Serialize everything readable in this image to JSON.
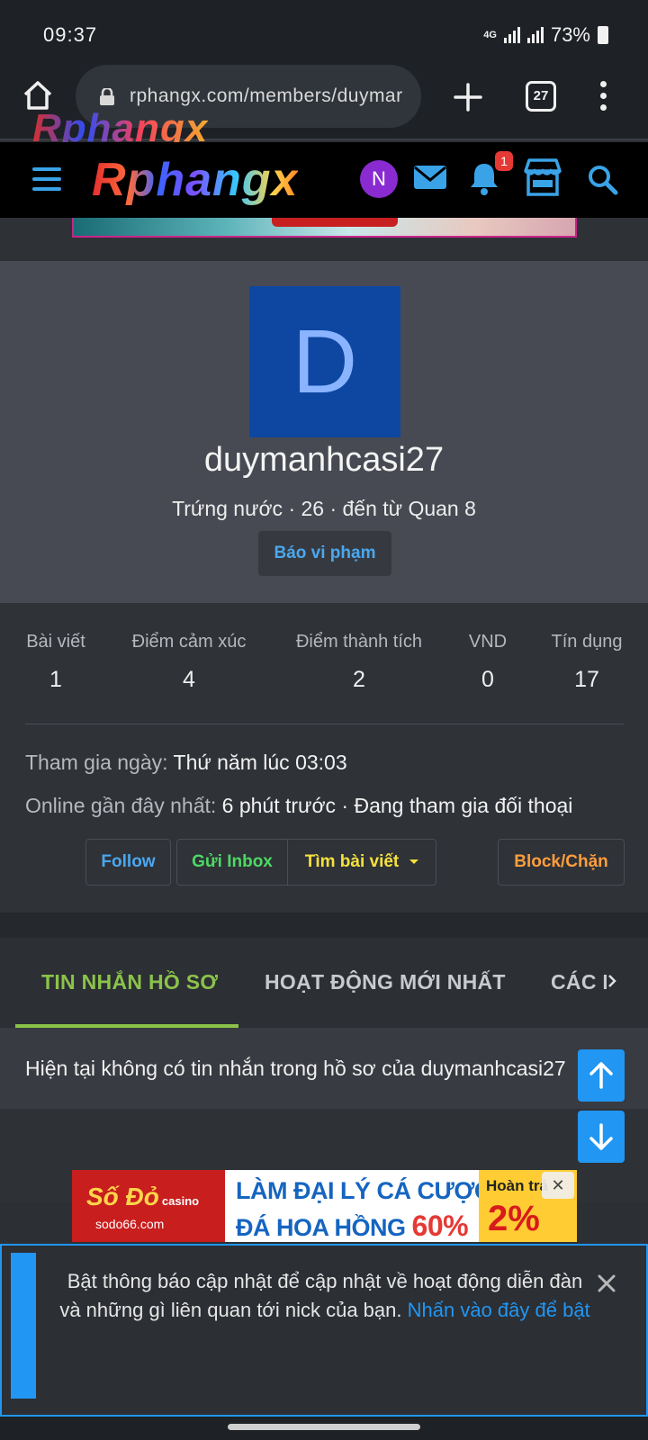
{
  "status_bar": {
    "time": "09:37",
    "network": "4G",
    "battery": "73%"
  },
  "browser": {
    "url": "rphangx.com/members/duymar",
    "tabs_count": "27",
    "watermark": "Rphangx"
  },
  "header": {
    "logo": "Rphangx",
    "avatar_letter": "N",
    "notification_count": "1",
    "accent_color": "#3aa3e8"
  },
  "profile": {
    "avatar_letter": "D",
    "username": "duymanhcasi27",
    "info": "Trứng nước · 26 · đến từ Quan 8",
    "report_label": "Báo vi phạm"
  },
  "stats": [
    {
      "label": "Bài viết",
      "value": "1"
    },
    {
      "label": "Điểm cảm xúc",
      "value": "4"
    },
    {
      "label": "Điểm thành tích",
      "value": "2"
    },
    {
      "label": "VND",
      "value": "0"
    },
    {
      "label": "Tín dụng",
      "value": "17"
    }
  ],
  "joined": {
    "label": "Tham gia ngày:",
    "value": "Thứ năm lúc 03:03"
  },
  "last_seen": {
    "label": "Online gần đây nhất:",
    "value": "6 phút trước · Đang tham gia đối thoại"
  },
  "actions": {
    "follow": "Follow",
    "inbox": "Gửi Inbox",
    "find_posts": "Tìm bài viết",
    "block": "Block/Chặn"
  },
  "tabs": [
    {
      "label": "TIN NHẮN HỒ SƠ",
      "active": true
    },
    {
      "label": "HOẠT ĐỘNG MỚI NHẤT",
      "active": false
    },
    {
      "label": "CÁC B",
      "active": false
    }
  ],
  "empty_message": "Hiện tại không có tin nhắn trong hồ sơ của duymanhcasi27",
  "ad": {
    "brand": "Số Đỏ",
    "brand_tag": "casino",
    "site": "sodo66.com",
    "line1": "LÀM ĐẠI LÝ CÁ CƯỢC BÓNG",
    "line2_prefix": "ĐÁ HOA HỒNG",
    "line2_pct": "60%",
    "side_label": "Hoàn trả",
    "side_value": "2%"
  },
  "notice": {
    "text": "Bật thông báo cập nhật để cập nhật về hoạt động diễn đàn và những gì liên quan tới nick của bạn.",
    "link": "Nhấn vào đây để bật"
  }
}
